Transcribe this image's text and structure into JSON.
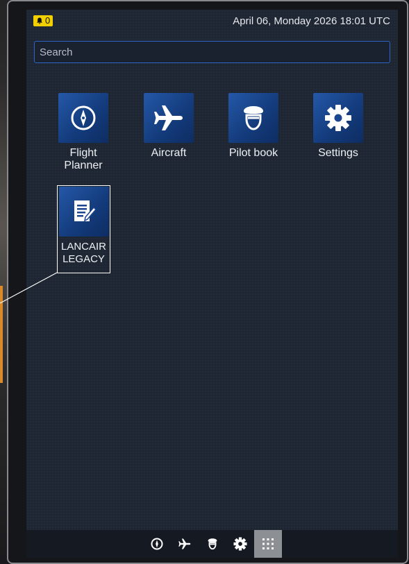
{
  "status": {
    "notification_count": "0",
    "datetime": "April 06, Monday 2026 18:01 UTC"
  },
  "search": {
    "placeholder": "Search",
    "value": ""
  },
  "apps": [
    {
      "label_line1": "Flight",
      "label_line2": "Planner",
      "icon": "compass-icon"
    },
    {
      "label": "Aircraft",
      "icon": "airplane-icon"
    },
    {
      "label": "Pilot book",
      "icon": "pilot-icon"
    },
    {
      "label": "Settings",
      "icon": "gear-icon"
    },
    {
      "label_line1": "LANCAIR",
      "label_line2": "LEGACY",
      "icon": "document-icon",
      "selected": true
    }
  ],
  "dock": [
    {
      "icon": "compass-icon"
    },
    {
      "icon": "airplane-icon"
    },
    {
      "icon": "pilot-icon"
    },
    {
      "icon": "gear-icon"
    },
    {
      "icon": "grid-icon",
      "active": true
    }
  ],
  "colors": {
    "accent": "#2e63c8",
    "badge": "#f2d000",
    "tile": "#1a4690",
    "screen": "#1e2633"
  }
}
